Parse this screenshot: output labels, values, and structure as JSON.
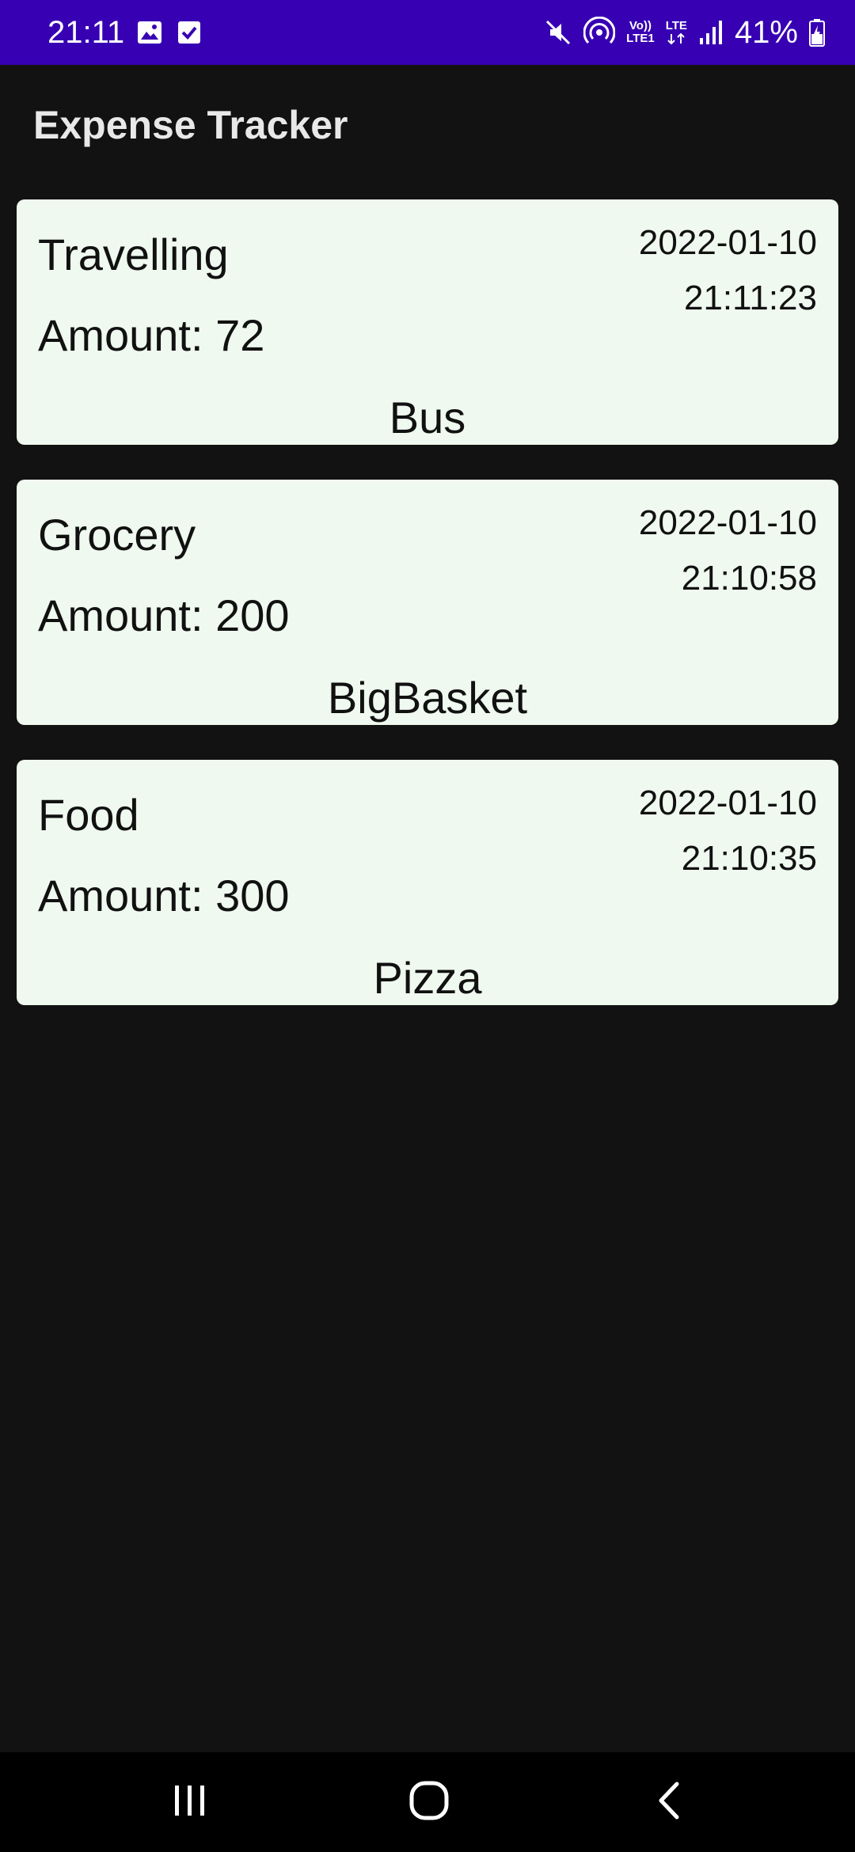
{
  "status_bar": {
    "time": "21:11",
    "left_icons": [
      "image-icon",
      "checkbox-icon"
    ],
    "right_icons": [
      "mute-icon",
      "hotspot-icon",
      "volte-icon",
      "lte-icon",
      "signal-icon",
      "battery-icon"
    ],
    "volte_label_top": "Vo))",
    "volte_label_bottom": "LTE1",
    "lte_label": "LTE",
    "battery": "41%",
    "color": "#3700b3"
  },
  "app": {
    "title": "Expense Tracker"
  },
  "expenses": [
    {
      "category": "Travelling",
      "amount_label": "Amount: 72",
      "date": "2022-01-10",
      "time": "21:11:23",
      "description": "Bus"
    },
    {
      "category": "Grocery",
      "amount_label": "Amount: 200",
      "date": "2022-01-10",
      "time": "21:10:58",
      "description": "BigBasket"
    },
    {
      "category": "Food",
      "amount_label": "Amount: 300",
      "date": "2022-01-10",
      "time": "21:10:35",
      "description": "Pizza"
    }
  ],
  "nav_bar": {
    "buttons": [
      "recent-apps-icon",
      "home-icon",
      "back-icon"
    ]
  },
  "colors": {
    "background": "#121212",
    "card": "#eff9ef",
    "status_bar": "#3700b3"
  }
}
